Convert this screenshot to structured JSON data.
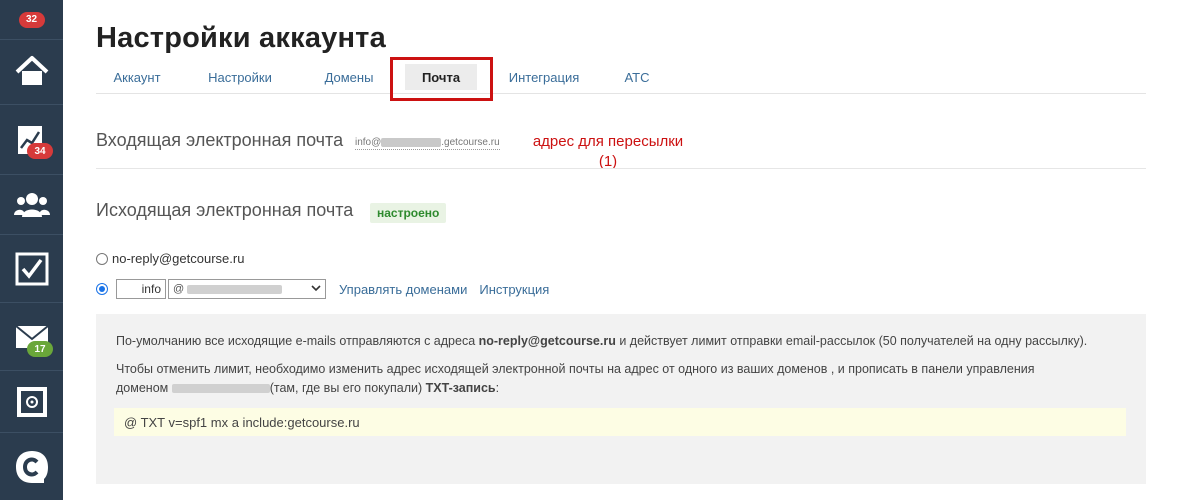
{
  "sidebar": {
    "items": [
      {
        "icon": "notifications-icon",
        "badge": "32",
        "badge_color": "#d63a3a"
      },
      {
        "icon": "home-icon",
        "badge": ""
      },
      {
        "icon": "chart-icon",
        "badge": "34",
        "badge_color": "#d63a3a"
      },
      {
        "icon": "users-icon",
        "badge": ""
      },
      {
        "icon": "checkbox-icon",
        "badge": ""
      },
      {
        "icon": "mail-icon",
        "badge": "17",
        "badge_color": "#6aa73a"
      },
      {
        "icon": "safe-icon",
        "badge": ""
      },
      {
        "icon": "getcourse-logo-icon",
        "badge": ""
      }
    ]
  },
  "page": {
    "title": "Настройки аккаунта"
  },
  "tabs": [
    {
      "label": "Аккаунт"
    },
    {
      "label": "Настройки"
    },
    {
      "label": "Домены"
    },
    {
      "label": "Почта",
      "active": true
    },
    {
      "label": "Интеграция"
    },
    {
      "label": "АТС"
    }
  ],
  "incoming": {
    "label": "Входящая электронная почта",
    "email_prefix": "info@",
    "email_suffix": ".getcourse.ru",
    "annotation_line1": "адрес для пересылки",
    "annotation_line2": "(1)"
  },
  "outgoing": {
    "label": "Исходящая электронная почта",
    "status": "настроено",
    "option_default": "no-reply@getcourse.ru",
    "custom_local_part": "info",
    "custom_domain_prefix": "@",
    "manage_domains_link": "Управлять доменами",
    "instructions_link": "Инструкция"
  },
  "info": {
    "p1_before": "По-умолчанию все исходящие e-mails отправляются с адреса ",
    "p1_bold": "no-reply@getcourse.ru",
    "p1_after": " и действует лимит отправки email-рассылок (50 получателей на одну рассылку).",
    "p2_line1": "Чтобы отменить лимит, необходимо изменить адрес исходящей электронной почты на адрес от одного из ваших доменов    , и прописать в панели управления",
    "p2_line2_before": "доменом ",
    "p2_line2_after": "(там, где вы его покупали) ",
    "p2_bold": "TXT-запись",
    "p2_end": ":",
    "txt_record": "@ TXT v=spf1 mx a include:getcourse.ru"
  },
  "colors": {
    "sidebar_bg": "#2b3c4e",
    "link": "#3a6d99",
    "annotation": "#cc1111",
    "status_green": "#2e8a2e"
  }
}
